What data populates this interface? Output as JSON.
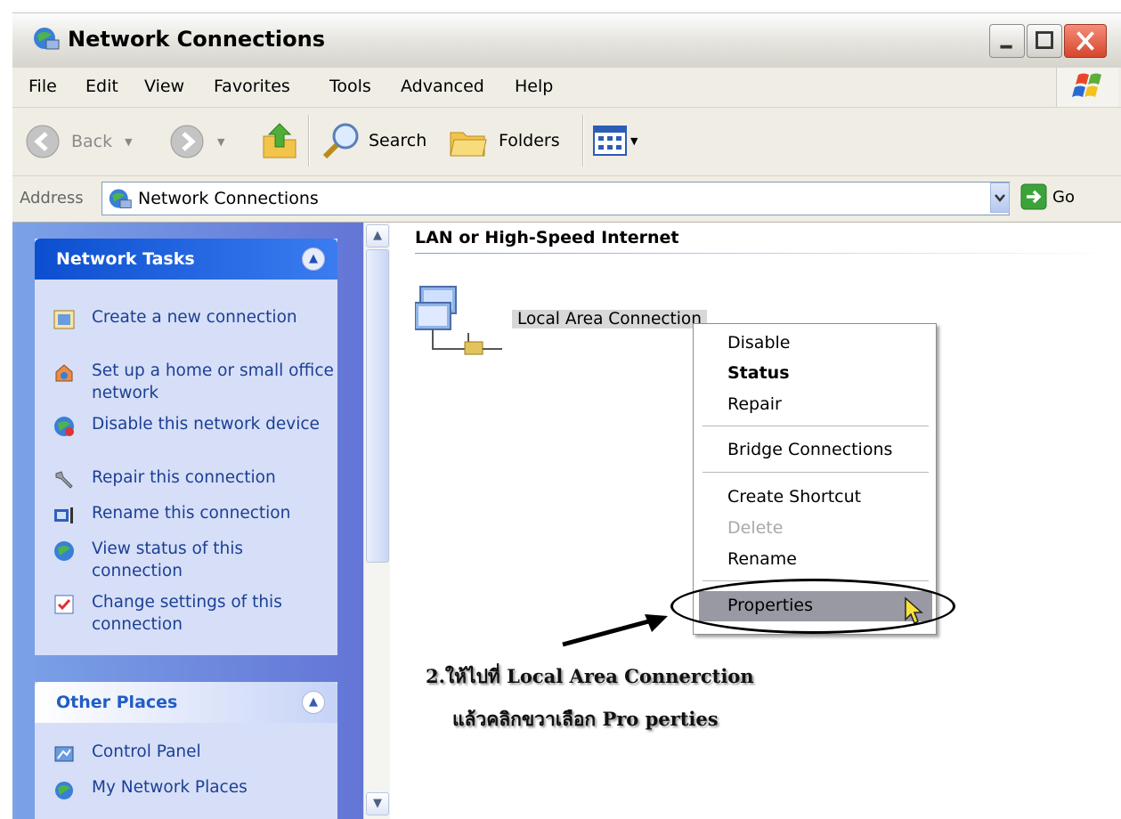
{
  "window": {
    "title": "Network Connections",
    "app_icon": "network-connections-icon"
  },
  "menu": [
    "File",
    "Edit",
    "View",
    "Favorites",
    "Tools",
    "Advanced",
    "Help"
  ],
  "toolbar": {
    "back_label": "Back",
    "search_label": "Search",
    "folders_label": "Folders"
  },
  "address": {
    "label": "Address",
    "value": "Network Connections",
    "go_label": "Go"
  },
  "network_tasks": {
    "title": "Network Tasks",
    "items": [
      {
        "label": "Create a new connection",
        "icon": "new-connection-icon"
      },
      {
        "label": "Set up a home or small office network",
        "icon": "home-network-icon"
      },
      {
        "label": "Disable this network device",
        "icon": "disable-device-icon"
      },
      {
        "label": "Repair this connection",
        "icon": "repair-icon"
      },
      {
        "label": "Rename this connection",
        "icon": "rename-icon"
      },
      {
        "label": "View status of this connection",
        "icon": "status-icon"
      },
      {
        "label": "Change settings of this connection",
        "icon": "settings-icon"
      }
    ]
  },
  "other_places": {
    "title": "Other Places",
    "items": [
      {
        "label": "Control Panel",
        "icon": "control-panel-icon"
      },
      {
        "label": "My Network Places",
        "icon": "network-places-icon"
      }
    ]
  },
  "main": {
    "group_header": "LAN or High-Speed Internet",
    "connection_label": "Local Area Connection"
  },
  "context_menu": {
    "items": [
      "Disable",
      "Status",
      "Repair",
      "Bridge Connections",
      "Create Shortcut",
      "Delete",
      "Rename",
      "Properties"
    ],
    "selected": "Properties"
  },
  "annotation": {
    "line1": "2.ให้ไปที่ Local   Area   Connerction",
    "line2": "แล้วคลิกขวาเลือก  Pro perties"
  },
  "colors": {
    "taskpane_header": "#0b4fd0",
    "task_link": "#1c3f95",
    "selection": "#9999a4"
  }
}
